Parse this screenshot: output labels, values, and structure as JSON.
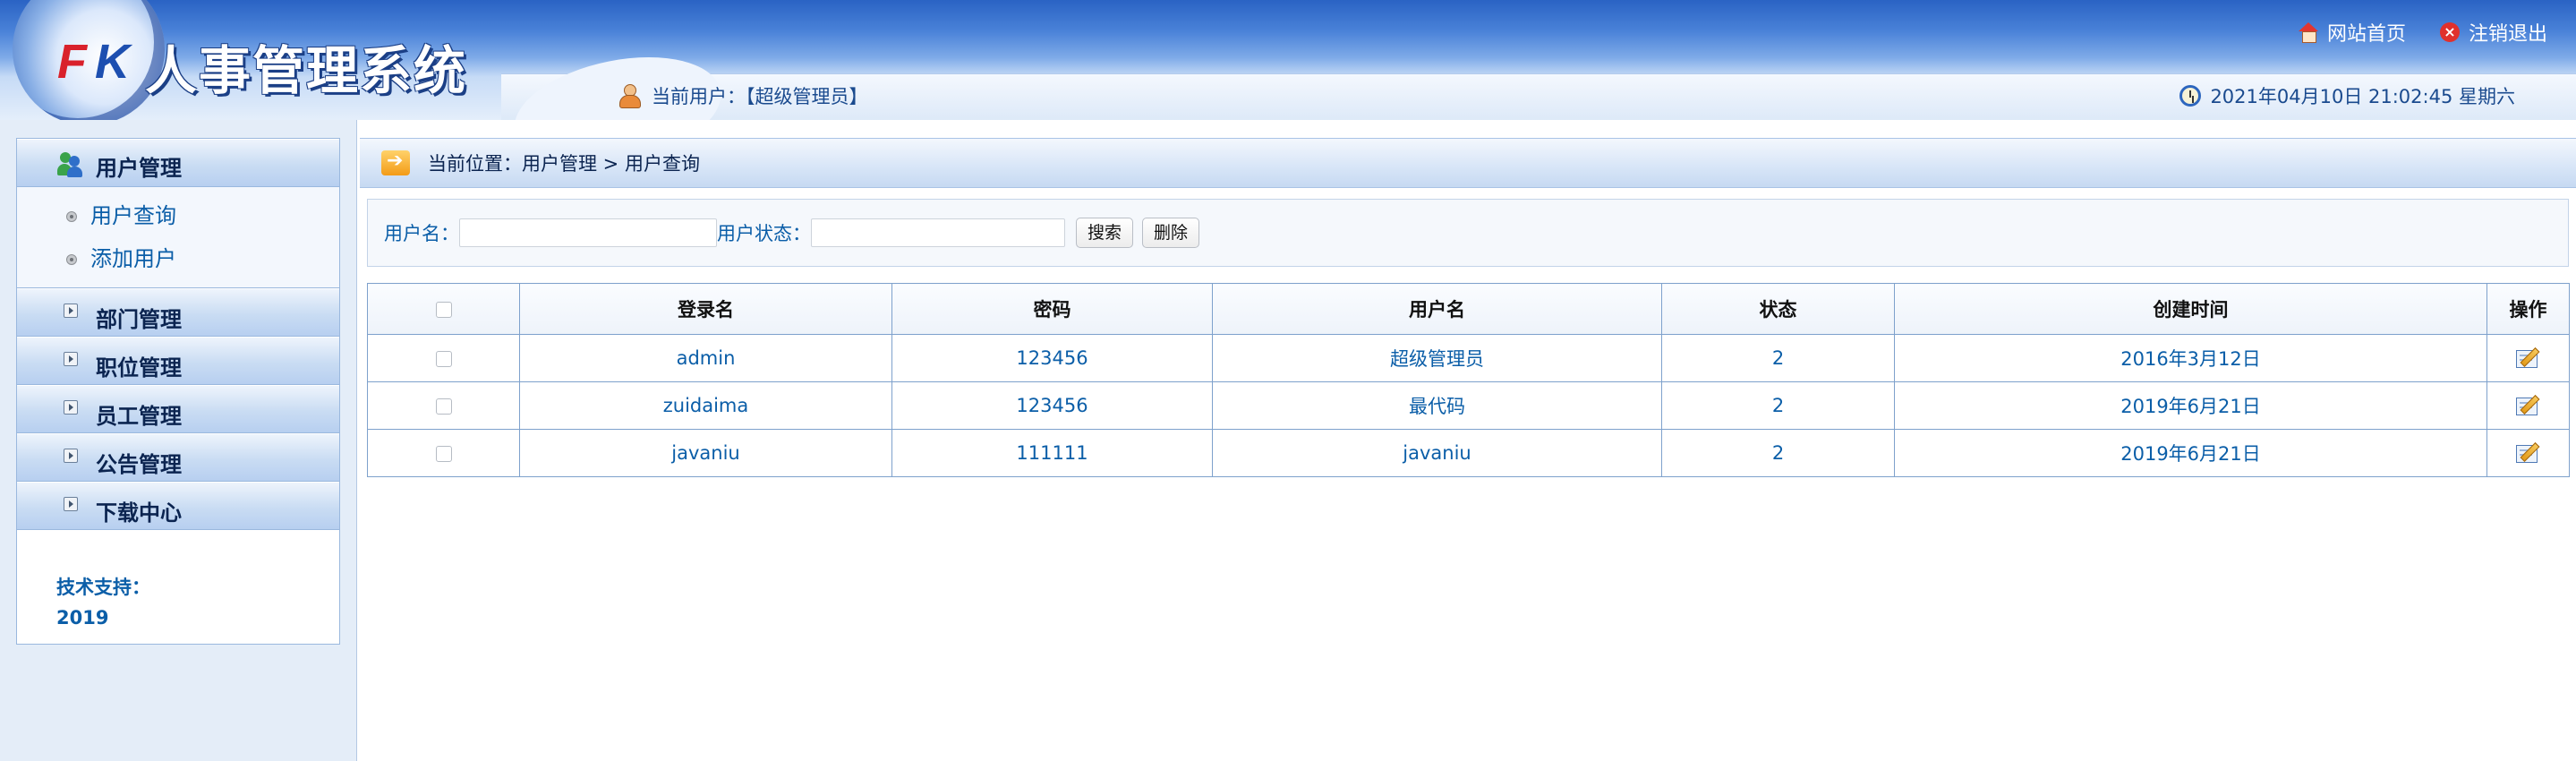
{
  "header": {
    "logo_f": "F",
    "logo_k": "K",
    "system_title": "人事管理系统",
    "home_link": "网站首页",
    "logout_link": "注销退出",
    "current_user_label": "当前用户：【超级管理员】",
    "datetime": "2021年04月10日 21:02:45 星期六"
  },
  "sidebar": {
    "menus": [
      {
        "label": "用户管理",
        "sub_items": [
          "用户查询",
          "添加用户"
        ]
      },
      {
        "label": "部门管理"
      },
      {
        "label": "职位管理"
      },
      {
        "label": "员工管理"
      },
      {
        "label": "公告管理"
      },
      {
        "label": "下载中心"
      }
    ],
    "support_label": "技术支持：",
    "support_value": "2019"
  },
  "breadcrumb": {
    "text": "当前位置：用户管理 > 用户查询"
  },
  "search": {
    "username_label": "用户名：",
    "username_value": "",
    "status_label": "用户状态：",
    "status_value": "",
    "search_button": "搜索",
    "delete_button": "删除"
  },
  "table": {
    "headers": [
      "登录名",
      "密码",
      "用户名",
      "状态",
      "创建时间",
      "操作"
    ],
    "rows": [
      {
        "login": "admin",
        "password": "123456",
        "name": "超级管理员",
        "status": "2",
        "created": "2016年3月12日"
      },
      {
        "login": "zuidaima",
        "password": "123456",
        "name": "最代码",
        "status": "2",
        "created": "2019年6月21日"
      },
      {
        "login": "javaniu",
        "password": "111111",
        "name": "javaniu",
        "status": "2",
        "created": "2019年6月21日"
      }
    ]
  },
  "icons": {
    "home": "home-icon",
    "logout": "logout-icon",
    "user": "user-icon",
    "clock": "clock-icon",
    "menu_users": "users-group-icon",
    "expand": "expand-arrow-icon",
    "bullet": "bullet-icon",
    "breadcrumb": "arrow-right-icon",
    "edit": "edit-icon"
  },
  "colors": {
    "header_blue": "#2a63c4",
    "link_blue": "#0b5ea8",
    "border_blue": "#7ea1cc"
  }
}
